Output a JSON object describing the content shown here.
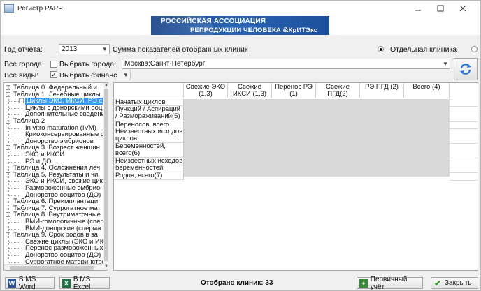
{
  "window": {
    "title": "Регистр РАРЧ"
  },
  "banner": {
    "line1": "РОССИЙСКАЯ АССОЦИАЦИЯ",
    "line2": "РЕПРОДУКЦИИ ЧЕЛОВЕКА",
    "amp": "&",
    "abbr": "КрИТЭкс"
  },
  "filters": {
    "year_label": "Год отчёта:",
    "year_value": "2013",
    "sum_label": "Сумма показателей отобранных клиник",
    "single_clinic_label": "Отдельная клиника",
    "sum_selected": true,
    "all_cities_label": "Все города:",
    "select_cities_label": "Выбрать города:",
    "select_cities_checked": false,
    "cities_value": "Москва;Санкт-Петербург",
    "all_types_label": "Все виды:",
    "select_finance_label": "Выбрать финанс.:",
    "select_finance_checked": true,
    "finance_value": ""
  },
  "tree": {
    "items": [
      {
        "text": "Таблица 0. Федеральный и"
      },
      {
        "text": "Таблица 1. Лечебные циклы"
      },
      {
        "text": "Циклы ЭКО, ИКСИ, РЭ с с"
      },
      {
        "text": "Циклы с донорскими ооц"
      },
      {
        "text": "Дополнительные сведени"
      },
      {
        "text": "Таблица 2"
      },
      {
        "text": "In vitro maturation (IVM)"
      },
      {
        "text": "Криоконсервированные с"
      },
      {
        "text": "Донорство эмбрионов"
      },
      {
        "text": "Таблица 3. Возраст женщин"
      },
      {
        "text": "ЭКО и ИКСИ"
      },
      {
        "text": "РЭ и ДО"
      },
      {
        "text": "Таблица 4. Осложнения леч"
      },
      {
        "text": "Таблица 5. Результаты и чи"
      },
      {
        "text": "ЭКО и ИКСИ, свежие цикл"
      },
      {
        "text": "Размороженные эмбрион"
      },
      {
        "text": "Донорство ооцитов (ДО)"
      },
      {
        "text": "Таблица 6. Преимплантаци"
      },
      {
        "text": "Таблица 7. Суррогатное мат"
      },
      {
        "text": "Таблица 8. Внутриматочные"
      },
      {
        "text": "ВМИ-гомологичные (сперм"
      },
      {
        "text": "ВМИ-донорские (спермa д"
      },
      {
        "text": "Таблица 9. Срок родов в за"
      },
      {
        "text": "Свежие циклы (ЭКО и ИК"
      },
      {
        "text": "Перенос размороженных"
      },
      {
        "text": "Донорство ооцитов (ДО)"
      },
      {
        "text": "Суррогатное материнство"
      }
    ]
  },
  "grid": {
    "columns": [
      "Свежие ЭКО (1,3)",
      "Свежие ИКСИ (1,3)",
      "Перенос РЭ (1)",
      "Свежие ПГД(2)",
      "РЭ ПГД (2)",
      "Всего (4)"
    ],
    "rows": [
      "Начатых циклов",
      "Пункций / Аспираций / Размораживаний(5)",
      "Переносов, всего",
      "Неизвестных исходов циклов",
      "Беременностей, всего(6)",
      "Неизвестных исходов беременностей",
      "Родов, всего(7)"
    ]
  },
  "footer": {
    "word_label": "В MS Word",
    "excel_label": "В MS Excel",
    "count_text": "Отобрано клиник: 33",
    "primary_label": "Первичный учёт",
    "close_label": "Закрыть"
  }
}
